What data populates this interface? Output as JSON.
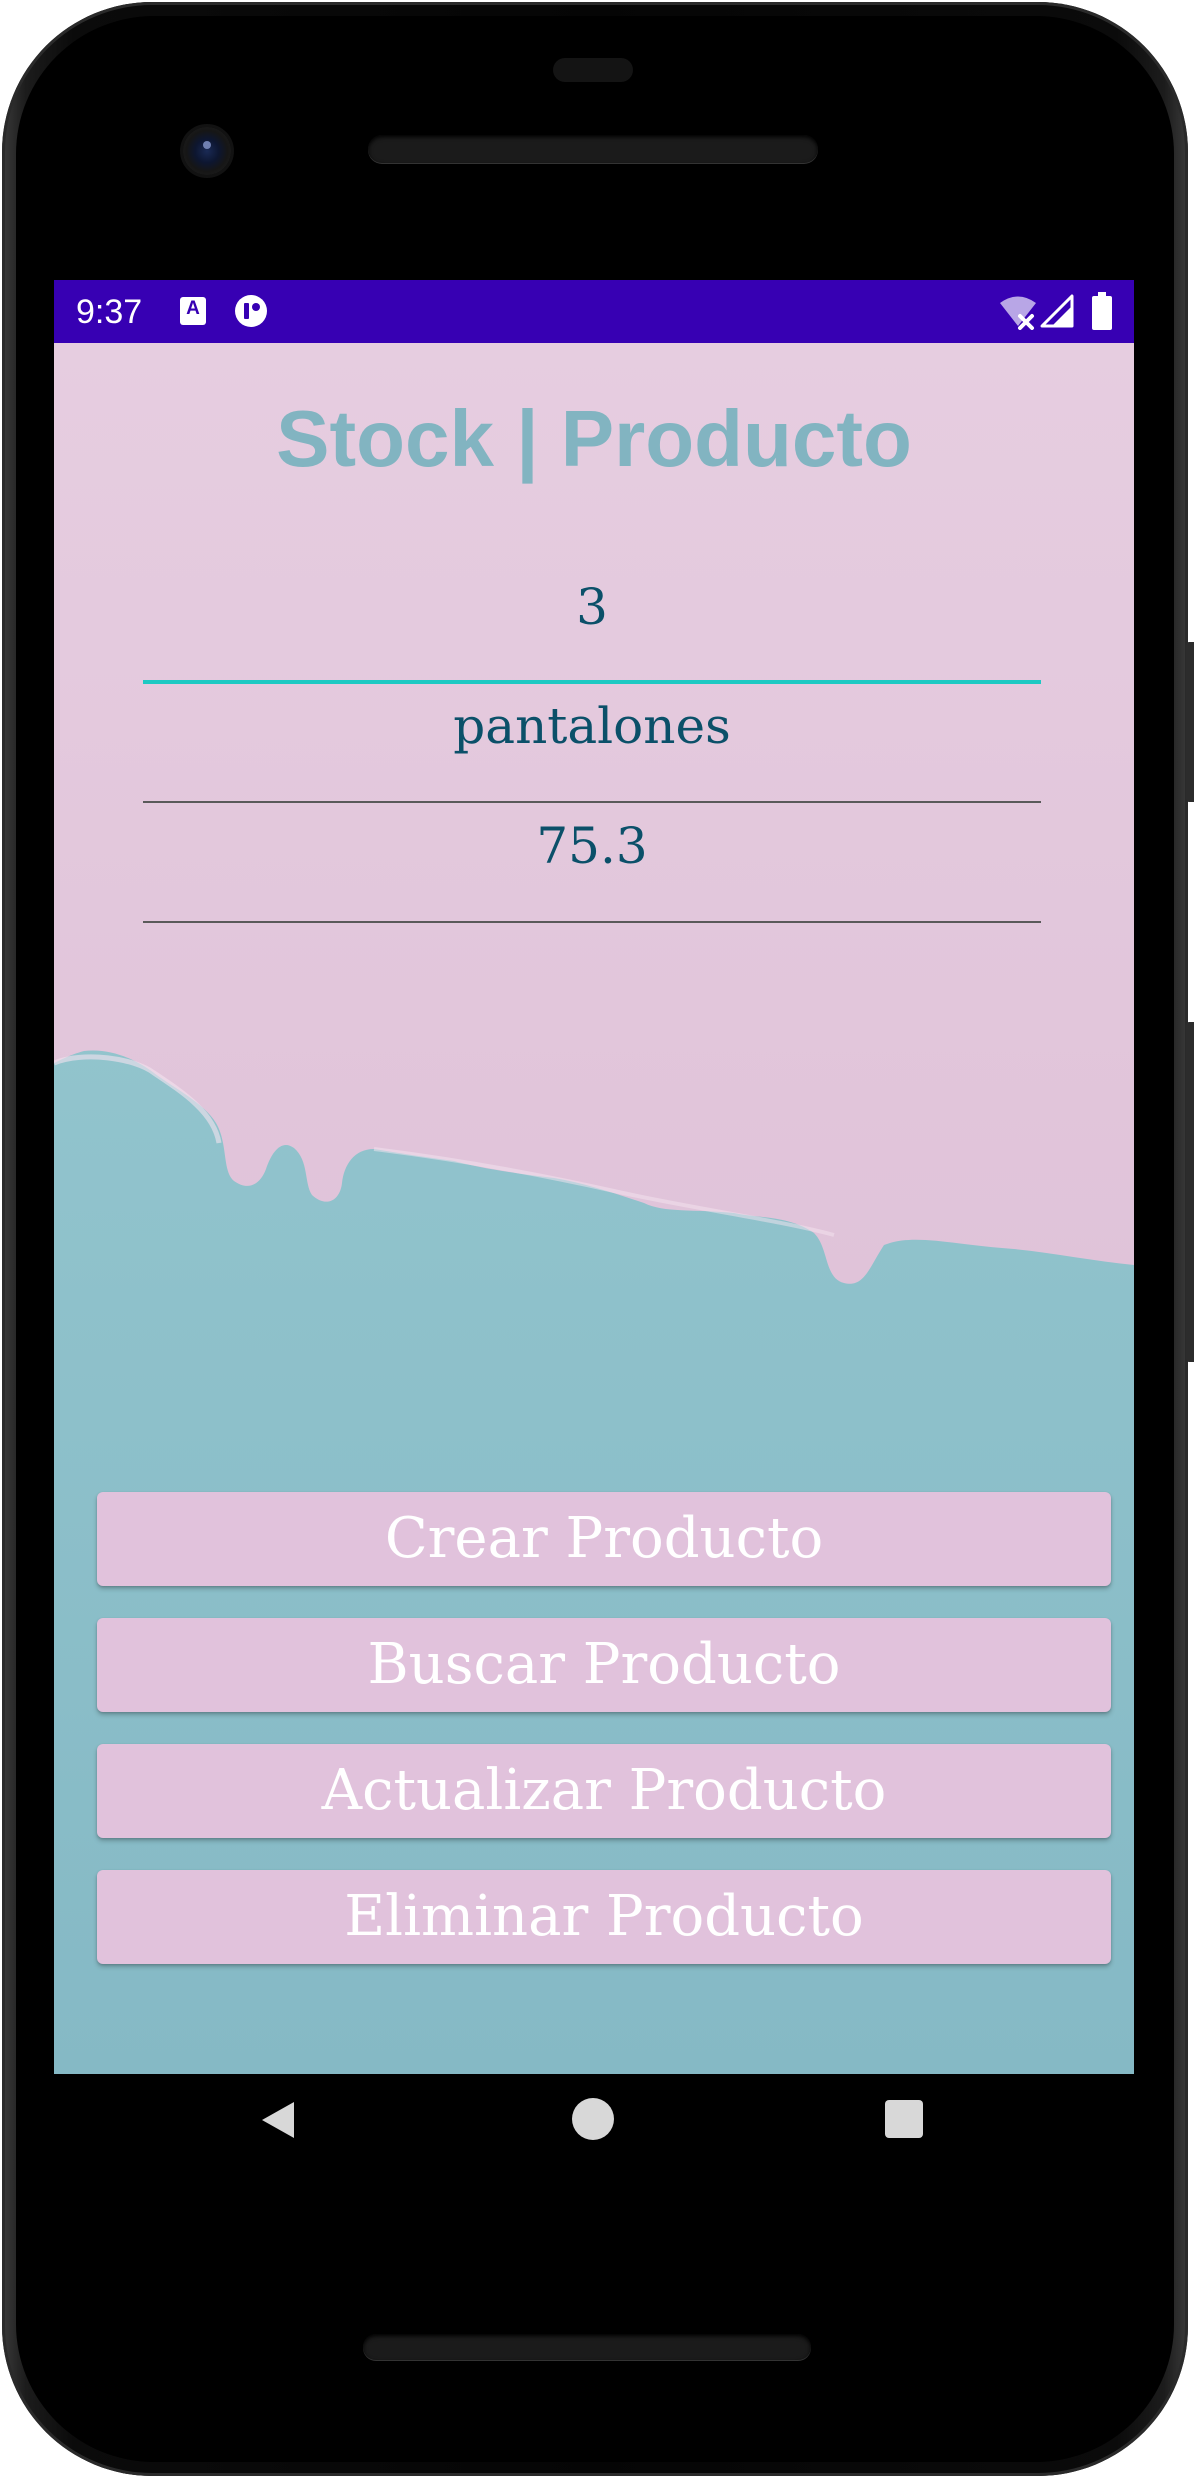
{
  "status_bar": {
    "time": "9:37",
    "notification_icons": [
      "accessibility-a-icon",
      "app-notification-icon"
    ],
    "system_icons": [
      "wifi-icon",
      "signal-icon",
      "battery-icon"
    ],
    "color": "#3700b3"
  },
  "app": {
    "title": "Stock | Producto",
    "fields": {
      "code": {
        "value": "3"
      },
      "name": {
        "value": "pantalones"
      },
      "price": {
        "value": "75.3"
      }
    },
    "buttons": {
      "create": "Crear Producto",
      "search": "Buscar Producto",
      "update": "Actualizar Producto",
      "delete": "Eliminar Producto"
    }
  },
  "navigation_bar": {
    "icons": [
      "back-icon",
      "home-icon",
      "recents-icon"
    ]
  },
  "colors": {
    "background_pink": "#e3c7dc",
    "background_teal": "#8fc1cb",
    "title_color": "#82b4c1",
    "field_text": "#0b5069",
    "focus_underline": "#1ec9c3",
    "button_bg": "#e1c2dc",
    "button_text": "#ffffff"
  }
}
